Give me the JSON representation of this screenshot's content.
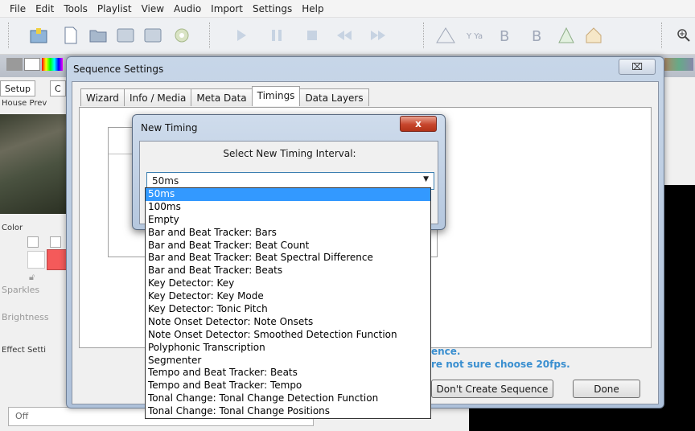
{
  "menubar": {
    "items": [
      {
        "label": "File"
      },
      {
        "label": "Edit"
      },
      {
        "label": "Tools"
      },
      {
        "label": "Playlist"
      },
      {
        "label": "View"
      },
      {
        "label": "Audio"
      },
      {
        "label": "Import"
      },
      {
        "label": "Settings"
      },
      {
        "label": "Help"
      }
    ]
  },
  "left_panel": {
    "tab_setup": "Setup",
    "tab_c": "C",
    "house_preview": "House Prev",
    "color": "Color",
    "sparkles": "Sparkles",
    "brightness": "Brightness",
    "effect_settings": "Effect Setti",
    "off_value": "Off"
  },
  "sequence_dialog": {
    "title": "Sequence Settings",
    "close": "⌧",
    "tabs": [
      {
        "label": "Wizard"
      },
      {
        "label": "Info / Media"
      },
      {
        "label": "Meta Data"
      },
      {
        "label": "Timings"
      },
      {
        "label": "Data Layers"
      }
    ],
    "active_tab": "Timings",
    "blue_line1": "ence.",
    "blue_line2": "re not sure choose 20fps.",
    "btn_dont_create": "Don't Create Sequence",
    "btn_done": "Done"
  },
  "new_timing_dialog": {
    "title": "New Timing",
    "close": "x",
    "label": "Select New Timing Interval:",
    "selected_value": "50ms"
  },
  "dropdown": {
    "selected_index": 0,
    "options": [
      "50ms",
      "100ms",
      "Empty",
      "Bar and Beat Tracker: Bars",
      "Bar and Beat Tracker: Beat Count",
      "Bar and Beat Tracker: Beat Spectral Difference",
      "Bar and Beat Tracker: Beats",
      "Key Detector: Key",
      "Key Detector: Key Mode",
      "Key Detector: Tonic Pitch",
      "Note Onset Detector: Note Onsets",
      "Note Onset Detector: Smoothed Detection Function",
      "Polyphonic Transcription",
      "Segmenter",
      "Tempo and Beat Tracker: Beats",
      "Tempo and Beat Tracker: Tempo",
      "Tonal Change: Tonal Change Detection Function",
      "Tonal Change: Tonal Change Positions"
    ]
  },
  "colors": {
    "selection": "#3399ff",
    "accent_blue_text": "#3a8fd0",
    "close_red": "#c7452c"
  }
}
